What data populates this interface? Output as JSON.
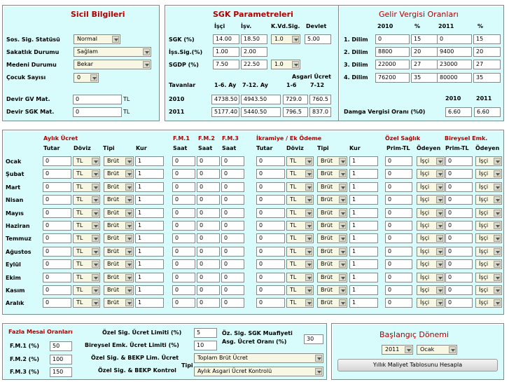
{
  "sicil": {
    "title": "Sicil Bilgileri",
    "sos_sig_label": "Sos. Sig. Statüsü",
    "sos_sig_value": "Normal",
    "sakatlik_label": "Sakatlık Durumu",
    "sakatlik_value": "Sağlam",
    "medeni_label": "Medeni Durumu",
    "medeni_value": "Bekar",
    "cocuk_label": "Çocuk Sayısı",
    "cocuk_value": "0",
    "devir_gv_label": "Devir GV Mat.",
    "devir_gv_value": "0",
    "devir_gv_unit": "TL",
    "devir_sgk_label": "Devir SGK Mat.",
    "devir_sgk_value": "0",
    "devir_sgk_unit": "TL"
  },
  "sgk": {
    "title": "SGK Parametreleri",
    "col_isci": "İşçi",
    "col_isv": "İşv.",
    "col_kvd": "K.Vd.Sig.",
    "col_devlet": "Devlet",
    "row_sgk_label": "SGK (%)",
    "row_sgk": [
      "14.00",
      "18.50",
      "1.0",
      "5.00"
    ],
    "row_iss_label": "İşs.Sig.(%)",
    "row_iss": [
      "1.00",
      "2.00"
    ],
    "row_sgdp_label": "SGDP (%)",
    "row_sgdp": [
      "7.50",
      "22.50",
      "1.0"
    ],
    "asgari_label": "Asgari Ücret",
    "tavanlar_label": "Tavanlar",
    "col_16": "1-6. Ay",
    "col_712": "7-12. Ay",
    "col_a16": "1-6",
    "col_a712": "7-12",
    "year1": "2010",
    "year1_values": [
      "4738.50",
      "4943.50",
      "729.0",
      "760.5"
    ],
    "year2": "2011",
    "year2_values": [
      "5177.40",
      "5440.50",
      "796.5",
      "837.0"
    ]
  },
  "gelir": {
    "title": "Gelir Vergisi Oranları",
    "col_2010": "2010",
    "col_pct1": "%",
    "col_2011": "2011",
    "col_pct2": "%",
    "rows": [
      {
        "label": "1. Dilim",
        "v1": "0",
        "p1": "15",
        "v2": "0",
        "p2": "15"
      },
      {
        "label": "2. Dilim",
        "v1": "8800",
        "p1": "20",
        "v2": "9400",
        "p2": "20"
      },
      {
        "label": "3. Dilim",
        "v1": "22000",
        "p1": "27",
        "v2": "23000",
        "p2": "27"
      },
      {
        "label": "4. Dilim",
        "v1": "76200",
        "p1": "35",
        "v2": "80000",
        "p2": "35"
      }
    ],
    "damga_year1": "2010",
    "damga_year2": "2011",
    "damga_label": "Damga Vergisi Oranı (%0)",
    "damga_v1": "6.60",
    "damga_v2": "6.60"
  },
  "monthly": {
    "aylik_title": "Aylık Ücret",
    "fm1_title": "F.M.1",
    "fm2_title": "F.M.2",
    "fm3_title": "F.M.3",
    "ikramiye_title": "İkramiye / Ek Ödeme",
    "ozel_saglik_title": "Özel Sağlık",
    "bireysel_title": "Bireysel Emk.",
    "h_tutar": "Tutar",
    "h_doviz": "Döviz",
    "h_tipi": "Tipi",
    "h_kur": "Kur",
    "h_saat": "Saat",
    "h_prim": "Prim-TL",
    "h_odeyen": "Ödeyen",
    "months": [
      "Ocak",
      "Şubat",
      "Mart",
      "Nisan",
      "Mayıs",
      "Haziran",
      "Temmuz",
      "Ağustos",
      "Eylül",
      "Ekim",
      "Kasım",
      "Aralık"
    ],
    "default_amount": "0",
    "default_currency": "TL",
    "default_type": "Brüt",
    "default_rate": "1",
    "default_payer": "İşçi"
  },
  "fazla": {
    "title": "Fazla Mesai Oranları",
    "fm1_label": "F.M.1 (%)",
    "fm1_value": "50",
    "fm2_label": "F.M.2 (%)",
    "fm2_value": "100",
    "fm3_label": "F.M.3 (%)",
    "fm3_value": "150",
    "ozel_limit_label": "Özel Sig. Ücret Limiti (%)",
    "ozel_limit_value": "5",
    "bireysel_limit_label": "Bireysel Emk. Ücret Limiti (%)",
    "bireysel_limit_value": "10",
    "bekp_lim_label": "Özel Sig. & BEKP Lim. Ücret",
    "bekp_lim_value": "Toplam Brüt Ücret",
    "bekp_kontrol_label": "Özel Sig. & BEKP Kontrol",
    "bekp_kontrol_suffix": "Tipi",
    "bekp_kontrol_value": "Aylık Asgari Ücret Kontrolü",
    "muafiyet_label1": "Öz. Sig. SGK Muafiyeti",
    "muafiyet_label2": "Asg. Ücret Oranı (%)",
    "muafiyet_value": "30"
  },
  "baslangic": {
    "title": "Başlangıç Dönemi",
    "year": "2011",
    "month": "Ocak",
    "calc_button": "Yıllık Maliyet Tablosunu Hesapla"
  },
  "colors": {
    "panel_bg": "#d8fcfc",
    "title_red": "#b00000",
    "select_bg": "#f8f7e4"
  }
}
